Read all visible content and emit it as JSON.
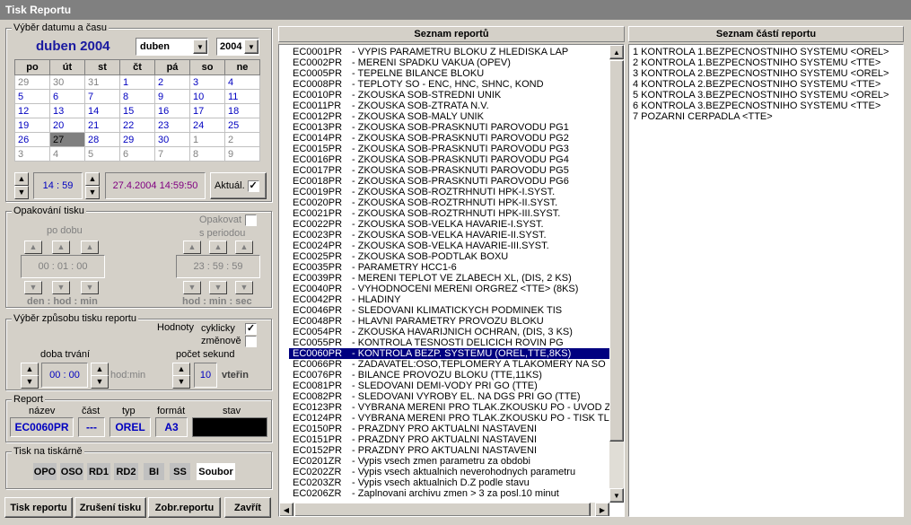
{
  "window": {
    "title": "Tisk Reportu"
  },
  "datetime_group": {
    "label": "Výběr datumu a času",
    "month_title": "duben 2004",
    "month_select": "duben",
    "year_select": "2004",
    "weekdays": [
      "po",
      "út",
      "st",
      "čt",
      "pá",
      "so",
      "ne"
    ],
    "weeks": [
      [
        {
          "d": "29",
          "o": true
        },
        {
          "d": "30",
          "o": true
        },
        {
          "d": "31",
          "o": true
        },
        {
          "d": "1"
        },
        {
          "d": "2"
        },
        {
          "d": "3"
        },
        {
          "d": "4"
        }
      ],
      [
        {
          "d": "5"
        },
        {
          "d": "6"
        },
        {
          "d": "7"
        },
        {
          "d": "8"
        },
        {
          "d": "9"
        },
        {
          "d": "10"
        },
        {
          "d": "11"
        }
      ],
      [
        {
          "d": "12"
        },
        {
          "d": "13"
        },
        {
          "d": "14"
        },
        {
          "d": "15"
        },
        {
          "d": "16"
        },
        {
          "d": "17"
        },
        {
          "d": "18"
        }
      ],
      [
        {
          "d": "19"
        },
        {
          "d": "20"
        },
        {
          "d": "21"
        },
        {
          "d": "22"
        },
        {
          "d": "23"
        },
        {
          "d": "24"
        },
        {
          "d": "25"
        }
      ],
      [
        {
          "d": "26"
        },
        {
          "d": "27",
          "s": true
        },
        {
          "d": "28"
        },
        {
          "d": "29"
        },
        {
          "d": "30"
        },
        {
          "d": "1",
          "o": true
        },
        {
          "d": "2",
          "o": true
        }
      ],
      [
        {
          "d": "3",
          "o": true
        },
        {
          "d": "4",
          "o": true
        },
        {
          "d": "5",
          "o": true
        },
        {
          "d": "6",
          "o": true
        },
        {
          "d": "7",
          "o": true
        },
        {
          "d": "8",
          "o": true
        },
        {
          "d": "9",
          "o": true
        }
      ]
    ],
    "time": "14 : 59",
    "datetime": "27.4.2004  14:59:50",
    "aktual_label": "Aktuál.",
    "aktual_checked": "✓"
  },
  "repeat_group": {
    "label": "Opakování tisku",
    "opakovat_label": "Opakovat",
    "po_dobu": "po dobu",
    "s_periodou": "s periodou",
    "duration_value": "00 : 01 : 00",
    "period_value": "23 : 59 : 59",
    "duration_units": "den : hod : min",
    "period_units": "hod : min : sec"
  },
  "mode_group": {
    "label": "Výběr způsobu tisku reportu",
    "hodnoty": "Hodnoty",
    "cyklicky": "cyklicky",
    "cyklicky_checked": "✓",
    "zmenove": "změnově",
    "doba_trvani": "doba trvání",
    "doba_value": "00 : 00",
    "hod_min": "hod:min",
    "pocet_sekund": "počet sekund",
    "sekund_value": "10",
    "vterin": "vteřin"
  },
  "report_group": {
    "label": "Report",
    "col_nazev": "název",
    "col_cast": "část",
    "col_typ": "typ",
    "col_format": "formát",
    "col_stav": "stav",
    "nazev": "EC0060PR",
    "cast": "---",
    "typ": "OREL",
    "format": "A3"
  },
  "printers_group": {
    "label": "Tisk na tiskárně",
    "printers": [
      "OPO",
      "OSO",
      "RD1",
      "RD2",
      "BI",
      "SS"
    ],
    "file": "Soubor"
  },
  "buttons": {
    "print": "Tisk reportu",
    "cancel": "Zrušení tisku",
    "show": "Zobr.reportu",
    "close": "Zavřít"
  },
  "reports_panel": {
    "header": "Seznam reportů",
    "items": [
      {
        "code": "EC0001PR",
        "name": "VYPIS PARAMETRU BLOKU Z HLEDISKA LAP"
      },
      {
        "code": "EC0002PR",
        "name": "MERENI SPADKU VAKUA (OPEV)"
      },
      {
        "code": "EC0005PR",
        "name": "TEPELNE BILANCE BLOKU"
      },
      {
        "code": "EC0008PR",
        "name": "TEPLOTY SO - ENC, HNC, SHNC, KOND"
      },
      {
        "code": "EC0010PR",
        "name": "ZKOUSKA SOB-STREDNI UNIK"
      },
      {
        "code": "EC0011PR",
        "name": "ZKOUSKA SOB-ZTRATA N.V."
      },
      {
        "code": "EC0012PR",
        "name": "ZKOUSKA SOB-MALY UNIK"
      },
      {
        "code": "EC0013PR",
        "name": "ZKOUSKA SOB-PRASKNUTI PAROVODU PG1"
      },
      {
        "code": "EC0014PR",
        "name": "ZKOUSKA SOB-PRASKNUTI PAROVODU PG2"
      },
      {
        "code": "EC0015PR",
        "name": "ZKOUSKA SOB-PRASKNUTI PAROVODU PG3"
      },
      {
        "code": "EC0016PR",
        "name": "ZKOUSKA SOB-PRASKNUTI PAROVODU PG4"
      },
      {
        "code": "EC0017PR",
        "name": "ZKOUSKA SOB-PRASKNUTI PAROVODU PG5"
      },
      {
        "code": "EC0018PR",
        "name": "ZKOUSKA SOB-PRASKNUTI PAROVODU PG6"
      },
      {
        "code": "EC0019PR",
        "name": "ZKOUSKA SOB-ROZTRHNUTI HPK-I.SYST."
      },
      {
        "code": "EC0020PR",
        "name": "ZKOUSKA SOB-ROZTRHNUTI HPK-II.SYST."
      },
      {
        "code": "EC0021PR",
        "name": "ZKOUSKA SOB-ROZTRHNUTI HPK-III.SYST."
      },
      {
        "code": "EC0022PR",
        "name": "ZKOUSKA SOB-VELKA HAVARIE-I.SYST."
      },
      {
        "code": "EC0023PR",
        "name": "ZKOUSKA SOB-VELKA HAVARIE-II.SYST."
      },
      {
        "code": "EC0024PR",
        "name": "ZKOUSKA SOB-VELKA HAVARIE-III.SYST."
      },
      {
        "code": "EC0025PR",
        "name": "ZKOUSKA SOB-PODTLAK BOXU"
      },
      {
        "code": "EC0035PR",
        "name": "PARAMETRY HCC1-6"
      },
      {
        "code": "EC0039PR",
        "name": "MERENI TEPLOT VE ZLABECH XL, (DIS, 2 KS)"
      },
      {
        "code": "EC0040PR",
        "name": "VYHODNOCENI MERENI ORGREZ <TTE> (8KS)"
      },
      {
        "code": "EC0042PR",
        "name": "HLADINY"
      },
      {
        "code": "EC0046PR",
        "name": "SLEDOVANI KLIMATICKYCH PODMINEK TIS"
      },
      {
        "code": "EC0048PR",
        "name": "HLAVNI PARAMETRY PROVOZU BLOKU"
      },
      {
        "code": "EC0054PR",
        "name": "ZKOUSKA HAVARIJNICH OCHRAN, (DIS, 3 KS)"
      },
      {
        "code": "EC0055PR",
        "name": "KONTROLA TESNOSTI DELICICH ROVIN PG"
      },
      {
        "code": "EC0060PR",
        "name": "KONTROLA BEZP. SYSTEMU (OREL,TTE,8KS)",
        "sel": true
      },
      {
        "code": "EC0066PR",
        "name": "ZADAVATEL:OSO,TEPLOMERY A TLAKOMERY NA SO"
      },
      {
        "code": "EC0076PR",
        "name": "BILANCE PROVOZU BLOKU (TTE,11KS)"
      },
      {
        "code": "EC0081PR",
        "name": "SLEDOVANI DEMI-VODY PRI GO (TTE)"
      },
      {
        "code": "EC0082PR",
        "name": "SLEDOVANI VYROBY EL. NA DGS PRI GO (TTE)"
      },
      {
        "code": "EC0123PR",
        "name": "VYBRANA MERENI PRO TLAK.ZKOUSKU PO - UVOD ZKO"
      },
      {
        "code": "EC0124PR",
        "name": "VYBRANA MERENI PRO TLAK.ZKOUSKU PO - TISK TLAK"
      },
      {
        "code": "EC0150PR",
        "name": "PRAZDNY PRO AKTUALNI NASTAVENI"
      },
      {
        "code": "EC0151PR",
        "name": "PRAZDNY PRO AKTUALNI NASTAVENI"
      },
      {
        "code": "EC0152PR",
        "name": "PRAZDNY PRO AKTUALNI NASTAVENI"
      },
      {
        "code": "EC0201ZR",
        "name": "Vypis vsech zmen parametru za obdobi"
      },
      {
        "code": "EC0202ZR",
        "name": "Vypis vsech aktualnich neverohodnych parametru"
      },
      {
        "code": "EC0203ZR",
        "name": "Vypis vsech aktualnich D.Z podle stavu"
      },
      {
        "code": "EC0206ZR",
        "name": "Zaplnovani archivu zmen > 3 za posl.10 minut"
      }
    ]
  },
  "parts_panel": {
    "header": "Seznam částí reportu",
    "items": [
      "1 KONTROLA 1.BEZPECNOSTNIHO SYSTEMU <OREL>",
      "2 KONTROLA 1.BEZPECNOSTNIHO SYSTEMU <TTE>",
      "3 KONTROLA 2.BEZPECNOSTNIHO SYSTEMU <OREL>",
      "4 KONTROLA 2.BEZPECNOSTNIHO SYSTEMU <TTE>",
      "5 KONTROLA 3.BEZPECNOSTNIHO SYSTEMU <OREL>",
      "6 KONTROLA 3.BEZPECNOSTNIHO SYSTEMU <TTE>",
      "7 POZARNI CERPADLA <TTE>"
    ]
  }
}
